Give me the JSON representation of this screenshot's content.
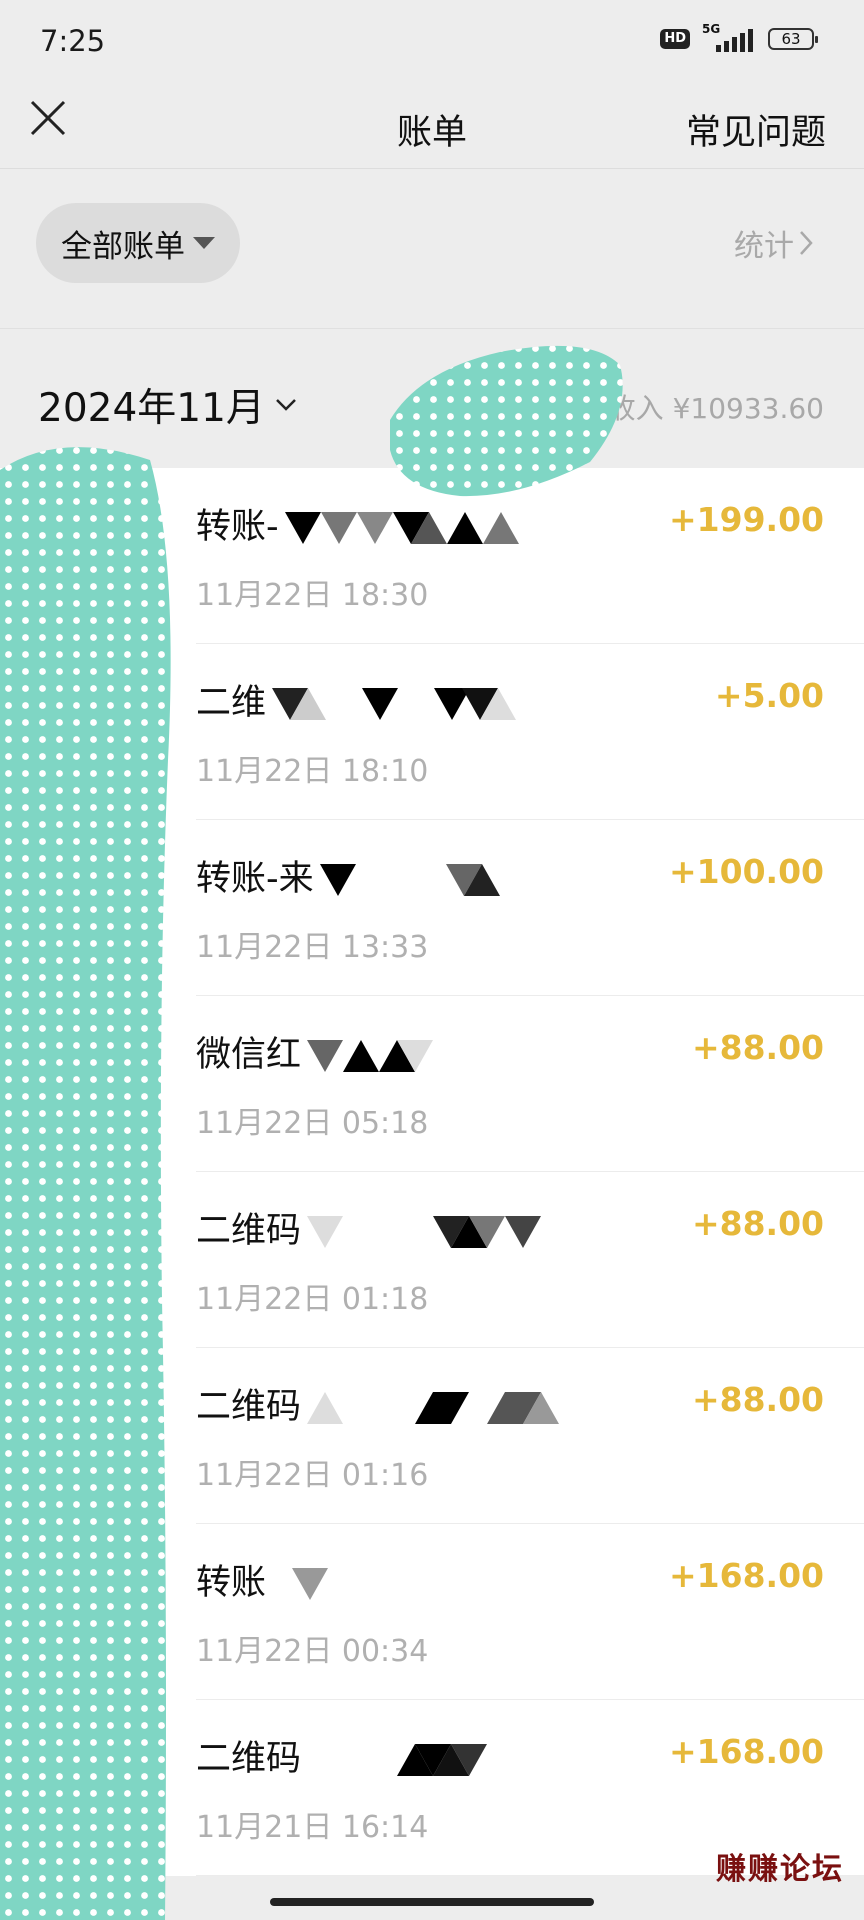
{
  "status": {
    "time": "7:25",
    "hd": "HD",
    "network": "5G",
    "battery": "63"
  },
  "nav": {
    "title": "账单",
    "faq": "常见问题"
  },
  "filter": {
    "label": "全部账单",
    "stats": "统计"
  },
  "month": {
    "label": "2024年11月",
    "income": "收入 ¥10933.60"
  },
  "transactions": [
    {
      "title": "转账-",
      "time": "11月22日 18:30",
      "amount": "+199.00"
    },
    {
      "title": "二维",
      "time": "11月22日 18:10",
      "amount": "+5.00"
    },
    {
      "title": "转账-来",
      "time": "11月22日 13:33",
      "amount": "+100.00"
    },
    {
      "title": "微信红",
      "time": "11月22日 05:18",
      "amount": "+88.00"
    },
    {
      "title": "二维码",
      "time": "11月22日 01:18",
      "amount": "+88.00"
    },
    {
      "title": "二维码",
      "time": "11月22日 01:16",
      "amount": "+88.00"
    },
    {
      "title": "转账",
      "time": "11月22日 00:34",
      "amount": "+168.00"
    },
    {
      "title": "二维码",
      "time": "11月21日 16:14",
      "amount": "+168.00"
    }
  ],
  "watermark": {
    "text": "赚赚论坛"
  },
  "colors": {
    "background": "#ededed",
    "amount": "#e6b83a",
    "overlay": "#7fd6c4"
  }
}
